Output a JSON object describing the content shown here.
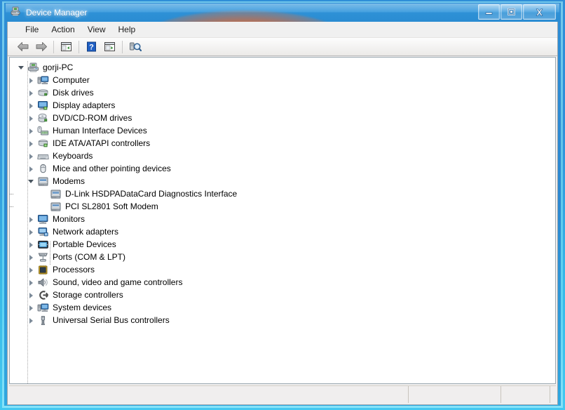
{
  "window": {
    "title": "Device Manager",
    "icon": "device-manager-icon",
    "buttons": {
      "minimize": "minimize-button",
      "maximize": "maximize-button",
      "close": "close-button"
    }
  },
  "menubar": {
    "items": [
      {
        "label": "File",
        "name": "menu-file"
      },
      {
        "label": "Action",
        "name": "menu-action"
      },
      {
        "label": "View",
        "name": "menu-view"
      },
      {
        "label": "Help",
        "name": "menu-help"
      }
    ]
  },
  "toolbar": {
    "buttons": [
      {
        "name": "back-button",
        "icon": "back-arrow-icon",
        "tooltip": "Back"
      },
      {
        "name": "forward-button",
        "icon": "forward-arrow-icon",
        "tooltip": "Forward"
      },
      {
        "name": "show-hide-tree-button",
        "icon": "console-tree-icon",
        "tooltip": "Show/Hide Console Tree"
      },
      {
        "name": "help-button",
        "icon": "help-question-icon",
        "tooltip": "Help"
      },
      {
        "name": "properties-button",
        "icon": "properties-panel-icon",
        "tooltip": "Properties"
      },
      {
        "name": "scan-hardware-button",
        "icon": "scan-hardware-icon",
        "tooltip": "Scan for hardware changes"
      }
    ]
  },
  "tree": {
    "root": {
      "label": "gorji-PC",
      "icon": "computer-root-icon",
      "expanded": true
    },
    "nodes": [
      {
        "label": "Computer",
        "icon": "computer-icon",
        "level": 1,
        "expander": "collapsed"
      },
      {
        "label": "Disk drives",
        "icon": "disk-drive-icon",
        "level": 1,
        "expander": "collapsed"
      },
      {
        "label": "Display adapters",
        "icon": "display-adapter-icon",
        "level": 1,
        "expander": "collapsed"
      },
      {
        "label": "DVD/CD-ROM drives",
        "icon": "dvd-drive-icon",
        "level": 1,
        "expander": "collapsed"
      },
      {
        "label": "Human Interface Devices",
        "icon": "hid-icon",
        "level": 1,
        "expander": "collapsed"
      },
      {
        "label": "IDE ATA/ATAPI controllers",
        "icon": "ide-controller-icon",
        "level": 1,
        "expander": "collapsed"
      },
      {
        "label": "Keyboards",
        "icon": "keyboard-icon",
        "level": 1,
        "expander": "collapsed"
      },
      {
        "label": "Mice and other pointing devices",
        "icon": "mouse-icon",
        "level": 1,
        "expander": "collapsed"
      },
      {
        "label": "Modems",
        "icon": "modem-icon",
        "level": 1,
        "expander": "expanded"
      },
      {
        "label": "D-Link HSDPADataCard Diagnostics Interface",
        "icon": "modem-icon",
        "level": 2,
        "expander": "none"
      },
      {
        "label": "PCI SL2801 Soft Modem",
        "icon": "modem-icon",
        "level": 2,
        "expander": "none"
      },
      {
        "label": "Monitors",
        "icon": "monitor-icon",
        "level": 1,
        "expander": "collapsed"
      },
      {
        "label": "Network adapters",
        "icon": "network-adapter-icon",
        "level": 1,
        "expander": "collapsed"
      },
      {
        "label": "Portable Devices",
        "icon": "portable-device-icon",
        "level": 1,
        "expander": "collapsed"
      },
      {
        "label": "Ports (COM & LPT)",
        "icon": "port-icon",
        "level": 1,
        "expander": "collapsed"
      },
      {
        "label": "Processors",
        "icon": "processor-icon",
        "level": 1,
        "expander": "collapsed"
      },
      {
        "label": "Sound, video and game controllers",
        "icon": "sound-icon",
        "level": 1,
        "expander": "collapsed"
      },
      {
        "label": "Storage controllers",
        "icon": "storage-controller-icon",
        "level": 1,
        "expander": "collapsed"
      },
      {
        "label": "System devices",
        "icon": "system-device-icon",
        "level": 1,
        "expander": "collapsed"
      },
      {
        "label": "Universal Serial Bus controllers",
        "icon": "usb-icon",
        "level": 1,
        "expander": "collapsed"
      }
    ]
  },
  "statusbar": {
    "panes": [
      "",
      "",
      "",
      ""
    ]
  },
  "colors": {
    "accent": "#2e8ed6",
    "glass": "#409ede",
    "glow": "#e86024",
    "client": "#f0eeee",
    "tree_bg": "#ffffff"
  }
}
